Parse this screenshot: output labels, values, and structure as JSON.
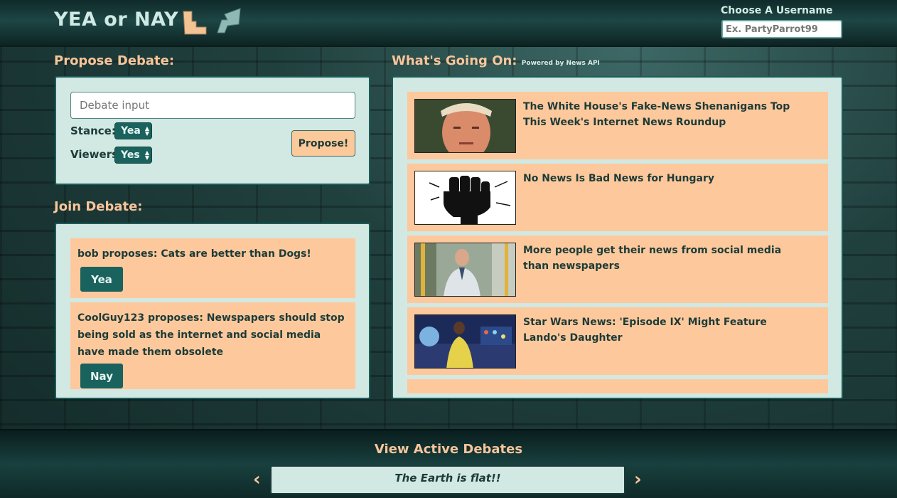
{
  "header": {
    "logo": "YEA or NAY",
    "username_label": "Choose A Username",
    "username_placeholder": "Ex. PartyParrot99"
  },
  "propose": {
    "title": "Propose Debate:",
    "input_placeholder": "Debate input",
    "stance_label": "Stance:",
    "stance_value": "Yea",
    "viewers_label": "Viewers:",
    "viewers_value": "Yes",
    "button_label": "Propose!"
  },
  "join": {
    "title": "Join Debate:",
    "debates": [
      {
        "text": "bob proposes: Cats are better than Dogs!",
        "button": "Yea"
      },
      {
        "text": "CoolGuy123 proposes: Newspapers should stop being sold as the internet and social media have made them obsolete",
        "button": "Nay"
      }
    ]
  },
  "news": {
    "title": "What's Going On:",
    "powered_by": "Powered by News API",
    "items": [
      {
        "title": "The White House's Fake-News Shenanigans Top This Week's Internet News Roundup",
        "thumb": "portrait-photo"
      },
      {
        "title": "No News Is Bad News for Hungary",
        "thumb": "fist-illustration"
      },
      {
        "title": "More people get their news from social media than newspapers",
        "thumb": "bus-passenger-photo"
      },
      {
        "title": "Star Wars News: 'Episode IX' Might Feature Lando's Daughter",
        "thumb": "cockpit-photo"
      }
    ]
  },
  "footer": {
    "title": "View Active Debates",
    "active_debate": "The Earth is flat!!",
    "prev": "‹",
    "next": "›"
  },
  "colors": {
    "accent_peach": "#fdc99c",
    "panel_bg": "#d2e8e3",
    "teal_button": "#1a625d",
    "title_orange": "#f7c59a"
  }
}
